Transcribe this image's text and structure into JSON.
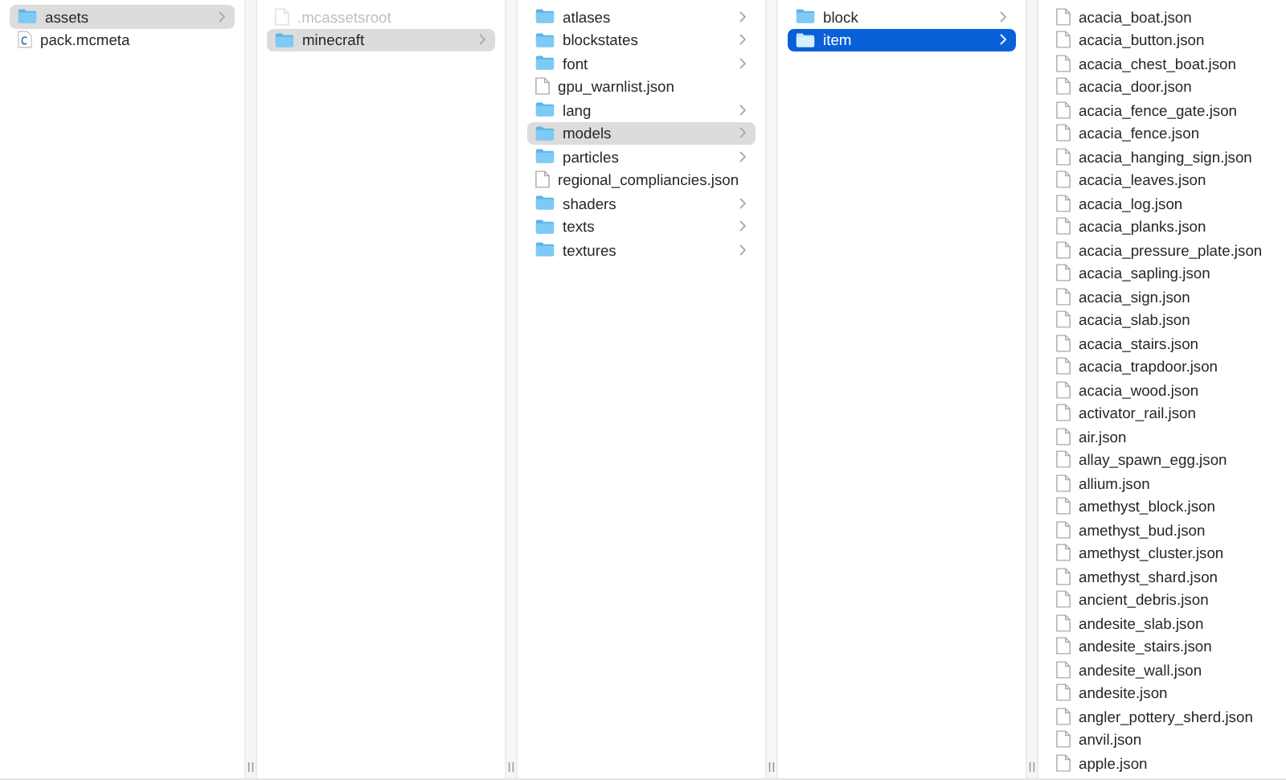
{
  "columns": [
    {
      "items": [
        {
          "name": "assets",
          "kind": "folder",
          "selected": true,
          "focused": false,
          "dimmed": false
        },
        {
          "name": "pack.mcmeta",
          "kind": "mcmeta",
          "selected": false,
          "focused": false,
          "dimmed": false
        }
      ]
    },
    {
      "items": [
        {
          "name": ".mcassetsroot",
          "kind": "file",
          "selected": false,
          "focused": false,
          "dimmed": true
        },
        {
          "name": "minecraft",
          "kind": "folder",
          "selected": true,
          "focused": false,
          "dimmed": false
        }
      ]
    },
    {
      "items": [
        {
          "name": "atlases",
          "kind": "folder",
          "selected": false,
          "focused": false,
          "dimmed": false
        },
        {
          "name": "blockstates",
          "kind": "folder",
          "selected": false,
          "focused": false,
          "dimmed": false
        },
        {
          "name": "font",
          "kind": "folder",
          "selected": false,
          "focused": false,
          "dimmed": false
        },
        {
          "name": "gpu_warnlist.json",
          "kind": "file",
          "selected": false,
          "focused": false,
          "dimmed": false
        },
        {
          "name": "lang",
          "kind": "folder",
          "selected": false,
          "focused": false,
          "dimmed": false
        },
        {
          "name": "models",
          "kind": "folder",
          "selected": true,
          "focused": false,
          "dimmed": false
        },
        {
          "name": "particles",
          "kind": "folder",
          "selected": false,
          "focused": false,
          "dimmed": false
        },
        {
          "name": "regional_compliancies.json",
          "kind": "file",
          "selected": false,
          "focused": false,
          "dimmed": false
        },
        {
          "name": "shaders",
          "kind": "folder",
          "selected": false,
          "focused": false,
          "dimmed": false
        },
        {
          "name": "texts",
          "kind": "folder",
          "selected": false,
          "focused": false,
          "dimmed": false
        },
        {
          "name": "textures",
          "kind": "folder",
          "selected": false,
          "focused": false,
          "dimmed": false
        }
      ]
    },
    {
      "items": [
        {
          "name": "block",
          "kind": "folder",
          "selected": false,
          "focused": false,
          "dimmed": false
        },
        {
          "name": "item",
          "kind": "folder",
          "selected": true,
          "focused": true,
          "dimmed": false
        }
      ]
    },
    {
      "items": [
        {
          "name": "acacia_boat.json",
          "kind": "file",
          "selected": false,
          "focused": false,
          "dimmed": false
        },
        {
          "name": "acacia_button.json",
          "kind": "file",
          "selected": false,
          "focused": false,
          "dimmed": false
        },
        {
          "name": "acacia_chest_boat.json",
          "kind": "file",
          "selected": false,
          "focused": false,
          "dimmed": false
        },
        {
          "name": "acacia_door.json",
          "kind": "file",
          "selected": false,
          "focused": false,
          "dimmed": false
        },
        {
          "name": "acacia_fence_gate.json",
          "kind": "file",
          "selected": false,
          "focused": false,
          "dimmed": false
        },
        {
          "name": "acacia_fence.json",
          "kind": "file",
          "selected": false,
          "focused": false,
          "dimmed": false
        },
        {
          "name": "acacia_hanging_sign.json",
          "kind": "file",
          "selected": false,
          "focused": false,
          "dimmed": false
        },
        {
          "name": "acacia_leaves.json",
          "kind": "file",
          "selected": false,
          "focused": false,
          "dimmed": false
        },
        {
          "name": "acacia_log.json",
          "kind": "file",
          "selected": false,
          "focused": false,
          "dimmed": false
        },
        {
          "name": "acacia_planks.json",
          "kind": "file",
          "selected": false,
          "focused": false,
          "dimmed": false
        },
        {
          "name": "acacia_pressure_plate.json",
          "kind": "file",
          "selected": false,
          "focused": false,
          "dimmed": false
        },
        {
          "name": "acacia_sapling.json",
          "kind": "file",
          "selected": false,
          "focused": false,
          "dimmed": false
        },
        {
          "name": "acacia_sign.json",
          "kind": "file",
          "selected": false,
          "focused": false,
          "dimmed": false
        },
        {
          "name": "acacia_slab.json",
          "kind": "file",
          "selected": false,
          "focused": false,
          "dimmed": false
        },
        {
          "name": "acacia_stairs.json",
          "kind": "file",
          "selected": false,
          "focused": false,
          "dimmed": false
        },
        {
          "name": "acacia_trapdoor.json",
          "kind": "file",
          "selected": false,
          "focused": false,
          "dimmed": false
        },
        {
          "name": "acacia_wood.json",
          "kind": "file",
          "selected": false,
          "focused": false,
          "dimmed": false
        },
        {
          "name": "activator_rail.json",
          "kind": "file",
          "selected": false,
          "focused": false,
          "dimmed": false
        },
        {
          "name": "air.json",
          "kind": "file",
          "selected": false,
          "focused": false,
          "dimmed": false
        },
        {
          "name": "allay_spawn_egg.json",
          "kind": "file",
          "selected": false,
          "focused": false,
          "dimmed": false
        },
        {
          "name": "allium.json",
          "kind": "file",
          "selected": false,
          "focused": false,
          "dimmed": false
        },
        {
          "name": "amethyst_block.json",
          "kind": "file",
          "selected": false,
          "focused": false,
          "dimmed": false
        },
        {
          "name": "amethyst_bud.json",
          "kind": "file",
          "selected": false,
          "focused": false,
          "dimmed": false
        },
        {
          "name": "amethyst_cluster.json",
          "kind": "file",
          "selected": false,
          "focused": false,
          "dimmed": false
        },
        {
          "name": "amethyst_shard.json",
          "kind": "file",
          "selected": false,
          "focused": false,
          "dimmed": false
        },
        {
          "name": "ancient_debris.json",
          "kind": "file",
          "selected": false,
          "focused": false,
          "dimmed": false
        },
        {
          "name": "andesite_slab.json",
          "kind": "file",
          "selected": false,
          "focused": false,
          "dimmed": false
        },
        {
          "name": "andesite_stairs.json",
          "kind": "file",
          "selected": false,
          "focused": false,
          "dimmed": false
        },
        {
          "name": "andesite_wall.json",
          "kind": "file",
          "selected": false,
          "focused": false,
          "dimmed": false
        },
        {
          "name": "andesite.json",
          "kind": "file",
          "selected": false,
          "focused": false,
          "dimmed": false
        },
        {
          "name": "angler_pottery_sherd.json",
          "kind": "file",
          "selected": false,
          "focused": false,
          "dimmed": false
        },
        {
          "name": "anvil.json",
          "kind": "file",
          "selected": false,
          "focused": false,
          "dimmed": false
        },
        {
          "name": "apple.json",
          "kind": "file",
          "selected": false,
          "focused": false,
          "dimmed": false
        }
      ]
    }
  ]
}
